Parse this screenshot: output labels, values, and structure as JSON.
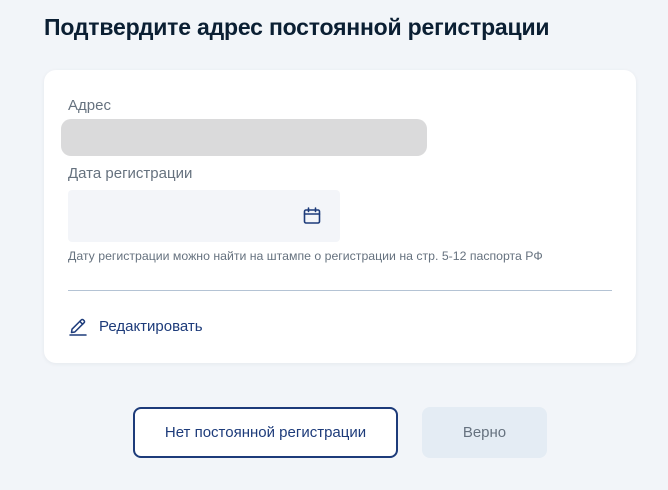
{
  "page": {
    "title": "Подтвердите адрес постоянной регистрации"
  },
  "form": {
    "address_label": "Адрес",
    "date_label": "Дата регистрации",
    "date_value": "",
    "date_hint": "Дату регистрации можно найти на штампе о регистрации на стр. 5-12 паспорта РФ",
    "edit_label": "Редактировать"
  },
  "actions": {
    "no_registration_label": "Нет постоянной регистрации",
    "confirm_label": "Верно"
  },
  "icons": {
    "date_field": "calendar-icon",
    "edit_link": "pencil-icon"
  },
  "colors": {
    "background": "#f2f5f9",
    "card": "#ffffff",
    "title": "#0b1f33",
    "muted_text": "#66727f",
    "accent": "#1d3b7a",
    "divider": "#b4c3d4",
    "disabled_button": "#e4ecf4"
  }
}
